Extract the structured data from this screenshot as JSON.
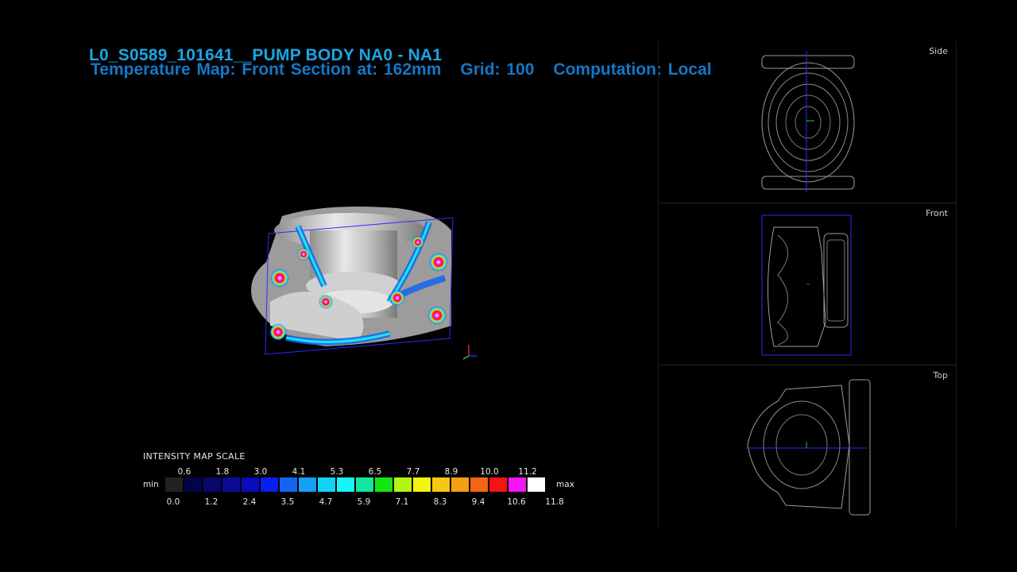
{
  "header": {
    "title": "L0_S0589_101641__PUMP BODY NA0 - NA1",
    "map_label": "Temperature Map: Front Section at:  162mm",
    "grid_label": "Grid: 100",
    "computation_label": "Computation:  Local"
  },
  "views": {
    "side_label": "Side",
    "front_label": "Front",
    "top_label": "Top"
  },
  "scale": {
    "title": "INTENSITY MAP SCALE",
    "min_label": "min",
    "max_label": "max",
    "top_ticks": [
      "0.6",
      "1.8",
      "3.0",
      "4.1",
      "5.3",
      "6.5",
      "7.7",
      "8.9",
      "10.0",
      "11.2"
    ],
    "bottom_ticks": [
      "0.0",
      "1.2",
      "2.4",
      "3.5",
      "4.7",
      "5.9",
      "7.1",
      "8.3",
      "9.4",
      "10.6",
      "11.8"
    ],
    "colors": [
      "#222222",
      "#03034a",
      "#08086a",
      "#0a0a94",
      "#0a0abe",
      "#0a1ef0",
      "#1464f0",
      "#14a0f5",
      "#14d2f5",
      "#14f5f5",
      "#14e6a0",
      "#14e614",
      "#b4f514",
      "#f5f514",
      "#f5c814",
      "#f5a014",
      "#f56414",
      "#f51414",
      "#f514f5",
      "#ffffff"
    ]
  }
}
